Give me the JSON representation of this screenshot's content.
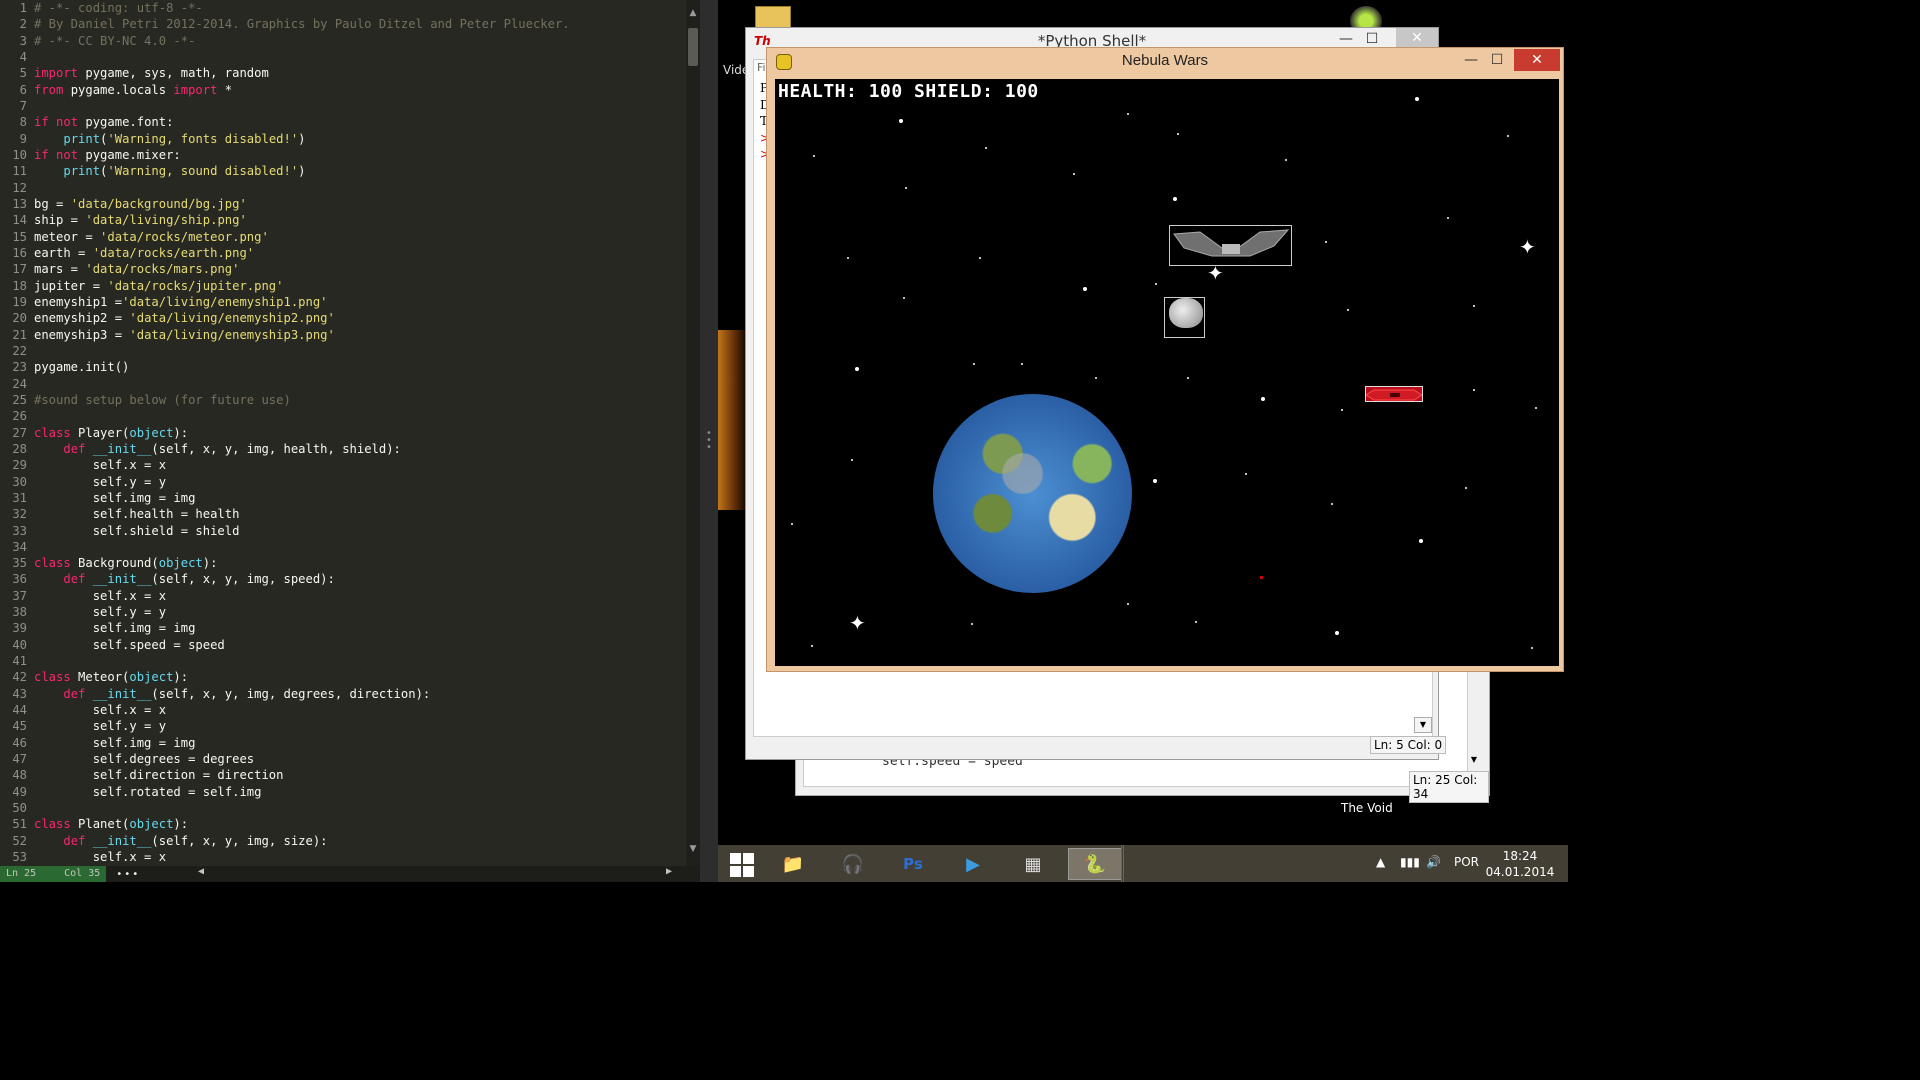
{
  "editor": {
    "lines": [
      {
        "n": "1",
        "t": "# -*- coding: utf-8 -*-",
        "c": "comment"
      },
      {
        "n": "2",
        "t": "# By Daniel Petri 2012-2014. Graphics by Paulo Ditzel and Peter Pluecker.",
        "c": "comment"
      },
      {
        "n": "3",
        "t": "# -*- CC BY-NC 4.0 -*-",
        "c": "comment"
      },
      {
        "n": "4",
        "t": "",
        "c": ""
      },
      {
        "n": "5",
        "t": "import pygame, sys, math, random",
        "c": ""
      },
      {
        "n": "6",
        "t": "from pygame.locals import *",
        "c": ""
      },
      {
        "n": "7",
        "t": "",
        "c": ""
      },
      {
        "n": "8",
        "t": "if not pygame.font:",
        "c": ""
      },
      {
        "n": "9",
        "t": "    print('Warning, fonts disabled!')",
        "c": ""
      },
      {
        "n": "10",
        "t": "if not pygame.mixer:",
        "c": ""
      },
      {
        "n": "11",
        "t": "    print('Warning, sound disabled!')",
        "c": ""
      },
      {
        "n": "12",
        "t": "",
        "c": ""
      },
      {
        "n": "13",
        "t": "bg = 'data/background/bg.jpg'",
        "c": ""
      },
      {
        "n": "14",
        "t": "ship = 'data/living/ship.png'",
        "c": ""
      },
      {
        "n": "15",
        "t": "meteor = 'data/rocks/meteor.png'",
        "c": ""
      },
      {
        "n": "16",
        "t": "earth = 'data/rocks/earth.png'",
        "c": ""
      },
      {
        "n": "17",
        "t": "mars = 'data/rocks/mars.png'",
        "c": ""
      },
      {
        "n": "18",
        "t": "jupiter = 'data/rocks/jupiter.png'",
        "c": ""
      },
      {
        "n": "19",
        "t": "enemyship1 ='data/living/enemyship1.png'",
        "c": ""
      },
      {
        "n": "20",
        "t": "enemyship2 = 'data/living/enemyship2.png'",
        "c": ""
      },
      {
        "n": "21",
        "t": "enemyship3 = 'data/living/enemyship3.png'",
        "c": ""
      },
      {
        "n": "22",
        "t": "",
        "c": ""
      },
      {
        "n": "23",
        "t": "pygame.init()",
        "c": ""
      },
      {
        "n": "24",
        "t": "",
        "c": ""
      },
      {
        "n": "25",
        "t": "#sound setup below (for future use)",
        "c": "comment"
      },
      {
        "n": "26",
        "t": "",
        "c": ""
      },
      {
        "n": "27",
        "t": "class Player(object):",
        "c": ""
      },
      {
        "n": "28",
        "t": "    def __init__(self, x, y, img, health, shield):",
        "c": ""
      },
      {
        "n": "29",
        "t": "        self.x = x",
        "c": ""
      },
      {
        "n": "30",
        "t": "        self.y = y",
        "c": ""
      },
      {
        "n": "31",
        "t": "        self.img = img",
        "c": ""
      },
      {
        "n": "32",
        "t": "        self.health = health",
        "c": ""
      },
      {
        "n": "33",
        "t": "        self.shield = shield",
        "c": ""
      },
      {
        "n": "34",
        "t": "",
        "c": ""
      },
      {
        "n": "35",
        "t": "class Background(object):",
        "c": ""
      },
      {
        "n": "36",
        "t": "    def __init__(self, x, y, img, speed):",
        "c": ""
      },
      {
        "n": "37",
        "t": "        self.x = x",
        "c": ""
      },
      {
        "n": "38",
        "t": "        self.y = y",
        "c": ""
      },
      {
        "n": "39",
        "t": "        self.img = img",
        "c": ""
      },
      {
        "n": "40",
        "t": "        self.speed = speed",
        "c": ""
      },
      {
        "n": "41",
        "t": "",
        "c": ""
      },
      {
        "n": "42",
        "t": "class Meteor(object):",
        "c": ""
      },
      {
        "n": "43",
        "t": "    def __init__(self, x, y, img, degrees, direction):",
        "c": ""
      },
      {
        "n": "44",
        "t": "        self.x = x",
        "c": ""
      },
      {
        "n": "45",
        "t": "        self.y = y",
        "c": ""
      },
      {
        "n": "46",
        "t": "        self.img = img",
        "c": ""
      },
      {
        "n": "47",
        "t": "        self.degrees = degrees",
        "c": ""
      },
      {
        "n": "48",
        "t": "        self.direction = direction",
        "c": ""
      },
      {
        "n": "49",
        "t": "        self.rotated = self.img",
        "c": ""
      },
      {
        "n": "50",
        "t": "",
        "c": ""
      },
      {
        "n": "51",
        "t": "class Planet(object):",
        "c": ""
      },
      {
        "n": "52",
        "t": "    def __init__(self, x, y, img, size):",
        "c": ""
      },
      {
        "n": "53",
        "t": "        self.x = x",
        "c": ""
      }
    ],
    "status": {
      "line": "Ln 25",
      "col": "Col 35",
      "dots": "•••"
    }
  },
  "desktop": {
    "video_label": "Vide",
    "void_label": "The Void"
  },
  "shell_back": {
    "ghost_text": "self.speed = speed",
    "status": "Ln: 25 Col: 34"
  },
  "shell": {
    "title": "*Python Shell*",
    "icon_text": "Th",
    "menu_text": "Fi",
    "prompts": [
      "P",
      "D",
      "T",
      ">",
      ">"
    ],
    "status": "Ln: 5 Col: 0",
    "minimize": "—",
    "maximize": "☐",
    "close": "✕"
  },
  "game": {
    "title": "Nebula Wars",
    "hud": "HEALTH: 100 SHIELD: 100",
    "minimize": "—",
    "maximize": "☐",
    "close": "✕"
  },
  "taskbar": {
    "apps": [
      {
        "name": "file-explorer",
        "glyph": "📁",
        "color": "#e8c35a"
      },
      {
        "name": "audio-player",
        "glyph": "🎧",
        "color": "#ffb300"
      },
      {
        "name": "photoshop",
        "glyph": "Ps",
        "color": "#2b6fd6"
      },
      {
        "name": "media-player",
        "glyph": "▶",
        "color": "#3a9be0"
      },
      {
        "name": "app-grid",
        "glyph": "▦",
        "color": "#ddd"
      },
      {
        "name": "python",
        "glyph": "🐍",
        "color": "#e8d36b"
      }
    ],
    "language": "POR",
    "time": "18:24",
    "date": "04.01.2014"
  },
  "colors": {
    "editor_bg": "#272822",
    "comment": "#75715e",
    "keyword": "#f92672",
    "string": "#e6db74",
    "function": "#66d9ef",
    "game_frame": "#eec8a0",
    "taskbar": "#433f35"
  }
}
